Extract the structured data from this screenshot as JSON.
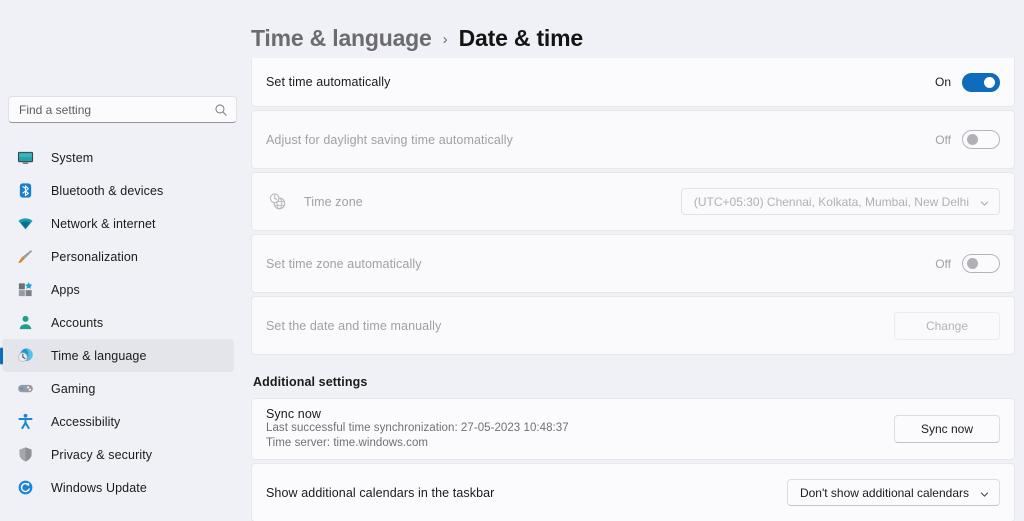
{
  "search": {
    "placeholder": "Find a setting",
    "value": "",
    "icon": "search-icon"
  },
  "sidebar": {
    "items": [
      {
        "label": "System",
        "icon": "monitor-icon",
        "selected": false
      },
      {
        "label": "Bluetooth & devices",
        "icon": "bluetooth-icon",
        "selected": false
      },
      {
        "label": "Network & internet",
        "icon": "wifi-icon",
        "selected": false
      },
      {
        "label": "Personalization",
        "icon": "paintbrush-icon",
        "selected": false
      },
      {
        "label": "Apps",
        "icon": "apps-grid-icon",
        "selected": false
      },
      {
        "label": "Accounts",
        "icon": "person-icon",
        "selected": false
      },
      {
        "label": "Time & language",
        "icon": "clock-globe-icon",
        "selected": true
      },
      {
        "label": "Gaming",
        "icon": "gamepad-icon",
        "selected": false
      },
      {
        "label": "Accessibility",
        "icon": "accessibility-person-icon",
        "selected": false
      },
      {
        "label": "Privacy & security",
        "icon": "shield-icon",
        "selected": false
      },
      {
        "label": "Windows Update",
        "icon": "refresh-circle-icon",
        "selected": false
      }
    ]
  },
  "breadcrumb": {
    "parent": "Time & language",
    "separator": "›",
    "current": "Date & time"
  },
  "settings": {
    "set_time_automatically": {
      "label": "Set time automatically",
      "state_label": "On",
      "state": "on"
    },
    "adjust_dst": {
      "label": "Adjust for daylight saving time automatically",
      "state_label": "Off",
      "state": "off"
    },
    "time_zone": {
      "label": "Time zone",
      "icon": "clock-globe-icon",
      "value": "(UTC+05:30) Chennai, Kolkata, Mumbai, New Delhi"
    },
    "set_time_zone_automatically": {
      "label": "Set time zone automatically",
      "state_label": "Off",
      "state": "off"
    },
    "set_date_time_manually": {
      "label": "Set the date and time manually",
      "button_label": "Change"
    }
  },
  "additional": {
    "heading": "Additional settings",
    "sync_now": {
      "label": "Sync now",
      "last_sync": "Last successful time synchronization: 27-05-2023 10:48:37",
      "time_server": "Time server: time.windows.com",
      "button_label": "Sync now"
    },
    "additional_calendars": {
      "label": "Show additional calendars in the taskbar",
      "value": "Don't show additional calendars"
    }
  },
  "colors": {
    "accent": "#0f6cbd",
    "page_bg": "#eff1f6",
    "card_bg": "#fbfbfd",
    "selected_bg": "#e3e5ea"
  }
}
